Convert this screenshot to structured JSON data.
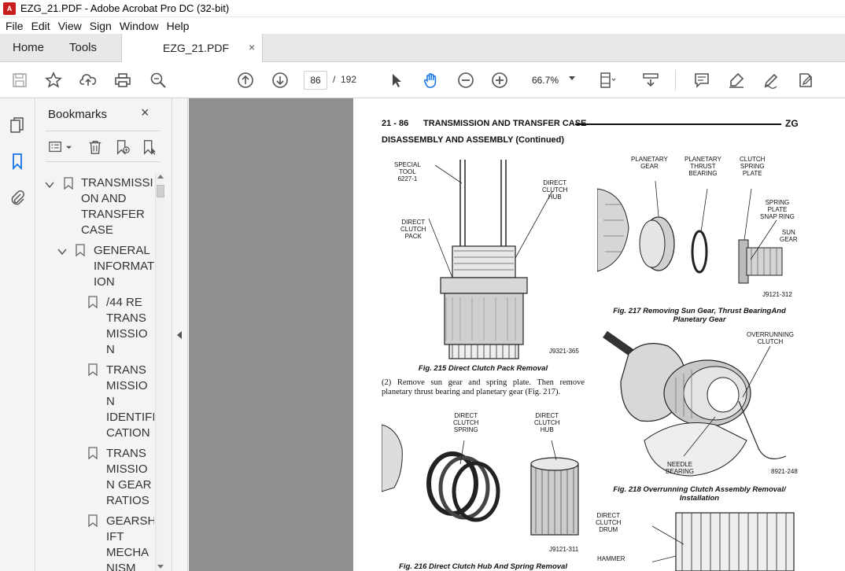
{
  "window": {
    "title": "EZG_21.PDF - Adobe Acrobat Pro DC (32-bit)",
    "app_icon_text": "A"
  },
  "menu": [
    "File",
    "Edit",
    "View",
    "Sign",
    "Window",
    "Help"
  ],
  "tabs": {
    "home": "Home",
    "tools": "Tools",
    "document": "EZG_21.PDF",
    "close": "×"
  },
  "toolbar": {
    "page_current": "86",
    "page_separator": "/",
    "page_total": "192",
    "zoom": "66.7%",
    "icons": [
      "save-icon",
      "bookmark-star-icon",
      "upload-icon",
      "print-icon",
      "zoom-search-icon",
      "page-up-icon",
      "page-down-icon",
      "select-arrow-icon",
      "hand-icon",
      "zoom-out-icon",
      "zoom-in-icon",
      "page-fit-icon",
      "scroll-mode-icon",
      "comment-icon",
      "highlight-icon",
      "sign-icon",
      "edit-pdf-icon"
    ]
  },
  "bookmarks": {
    "title": "Bookmarks",
    "close": "×",
    "items": [
      {
        "label_lines": [
          "TRANSMISSI",
          "ON AND",
          "TRANSFER",
          "CASE"
        ],
        "level": 0,
        "expanded": true
      },
      {
        "label_lines": [
          "GENERAL",
          "INFORMAT",
          "ION"
        ],
        "level": 1,
        "expanded": true
      },
      {
        "label_lines": [
          "/44 RE",
          "TRANS",
          "MISSIO",
          "N"
        ],
        "level": 2
      },
      {
        "label_lines": [
          "TRANS",
          "MISSIO",
          "N",
          "IDENTIFI",
          "CATION"
        ],
        "level": 2
      },
      {
        "label_lines": [
          "TRANS",
          "MISSIO",
          "N GEAR",
          "RATIOS"
        ],
        "level": 2
      },
      {
        "label_lines": [
          "GEARSH",
          "IFT",
          "MECHA",
          "NISM"
        ],
        "level": 2
      }
    ]
  },
  "document_page": {
    "page_number": "21 - 86",
    "header_title": "TRANSMISSION AND TRANSFER CASE",
    "header_code": "ZG",
    "section": "DISASSEMBLY AND ASSEMBLY (Continued)",
    "fig215": {
      "caption": "Fig. 215 Direct Clutch Pack Removal",
      "code": "J9321-365",
      "labels": {
        "tool": [
          "SPECIAL",
          "TOOL",
          "6227-1"
        ],
        "hub": [
          "DIRECT",
          "CLUTCH",
          "HUB"
        ],
        "pack": [
          "DIRECT",
          "CLUTCH",
          "PACK"
        ]
      }
    },
    "body_text": "(2) Remove sun gear and spring plate. Then remove planetary thrust bearing and planetary gear (Fig. 217).",
    "fig216": {
      "caption": "Fig. 216 Direct Clutch Hub And Spring Removal",
      "code": "J9121-311",
      "labels": {
        "spring": [
          "DIRECT",
          "CLUTCH",
          "SPRING"
        ],
        "hub": [
          "DIRECT",
          "CLUTCH",
          "HUB"
        ]
      }
    },
    "fig217": {
      "caption_line1": "Fig. 217 Removing Sun Gear, Thrust BearingAnd",
      "caption_line2": "Planetary Gear",
      "code": "J9121-312",
      "labels": {
        "planetary": [
          "PLANETARY",
          "GEAR"
        ],
        "thrust": [
          "PLANETARY",
          "THRUST",
          "BEARING"
        ],
        "clutch_plate": [
          "CLUTCH",
          "SPRING",
          "PLATE"
        ],
        "snap": [
          "SPRING",
          "PLATE",
          "SNAP RING"
        ],
        "sun": [
          "SUN",
          "GEAR"
        ]
      }
    },
    "fig218": {
      "caption_line1": "Fig. 218 Overrunning Clutch Assembly Removal/",
      "caption_line2": "Installation",
      "code": "8921-248",
      "labels": {
        "overrunning": [
          "OVERRUNNING",
          "CLUTCH"
        ],
        "needle": [
          "NEEDLE",
          "BEARING"
        ]
      }
    },
    "fig219_partial": {
      "labels": {
        "drum": [
          "DIRECT",
          "CLUTCH",
          "DRUM"
        ],
        "hammer": [
          "HAMMER"
        ]
      }
    }
  }
}
